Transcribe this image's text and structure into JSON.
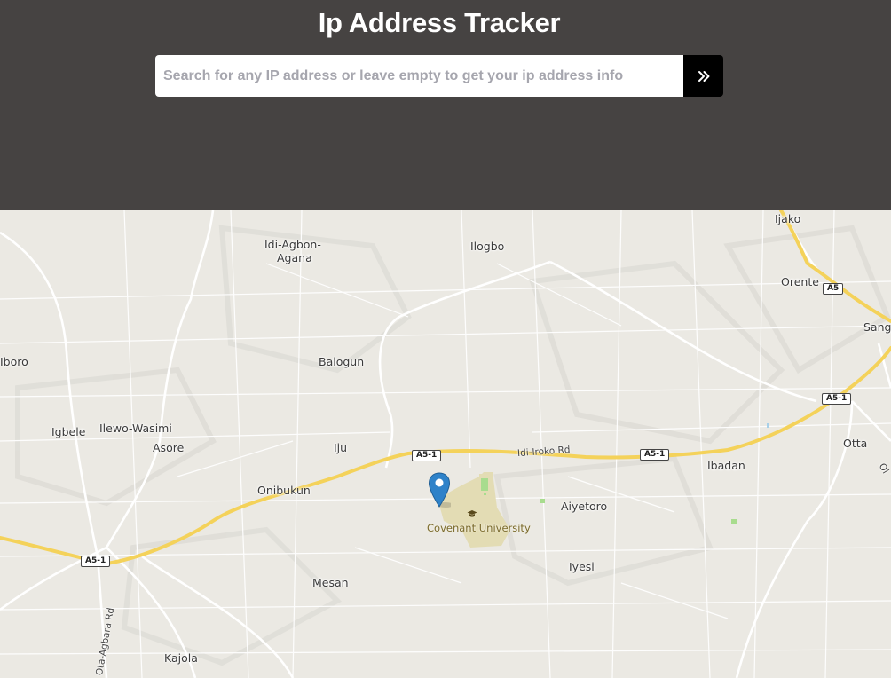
{
  "app": {
    "title": "Ip Address Tracker"
  },
  "search": {
    "placeholder": "Search for any IP address or leave empty to get your ip address info",
    "value": "",
    "submit_icon": "double-chevron-right-icon"
  },
  "map": {
    "places": {
      "idi_agbon_agana_1": "Idi-Agbon-",
      "idi_agbon_agana_2": "Agana",
      "ilogbo": "Ilogbo",
      "ijako": "Ijako",
      "orente": "Orente",
      "sango": "Sang",
      "iboro": "Iboro",
      "balogun": "Balogun",
      "igbele": "Igbele",
      "ilewo_wasimi": "Ilewo-Wasimi",
      "asore": "Asore",
      "iju": "Iju",
      "onibukun": "Onibukun",
      "aiyetoro": "Aiyetoro",
      "ibadan": "Ibadan",
      "otta": "Otta",
      "iyesi": "Iyesi",
      "mesan": "Mesan",
      "kajola": "Kajola"
    },
    "roads": {
      "idi_iroko": "Idi-Iroko Rd",
      "ota_agbara": "Ota-Agbara Rd",
      "edge_label": "Ol"
    },
    "shields": {
      "a5": "A5",
      "a5_1": "A5-1"
    },
    "poi": {
      "name": "Covenant University",
      "icon": "graduation-cap-icon"
    },
    "marker_icon": "map-pin-icon",
    "colors": {
      "header_bg": "#464342",
      "marker": "#2e82c9",
      "highway": "#f4d25a",
      "campus": "#e3dcb4"
    }
  }
}
